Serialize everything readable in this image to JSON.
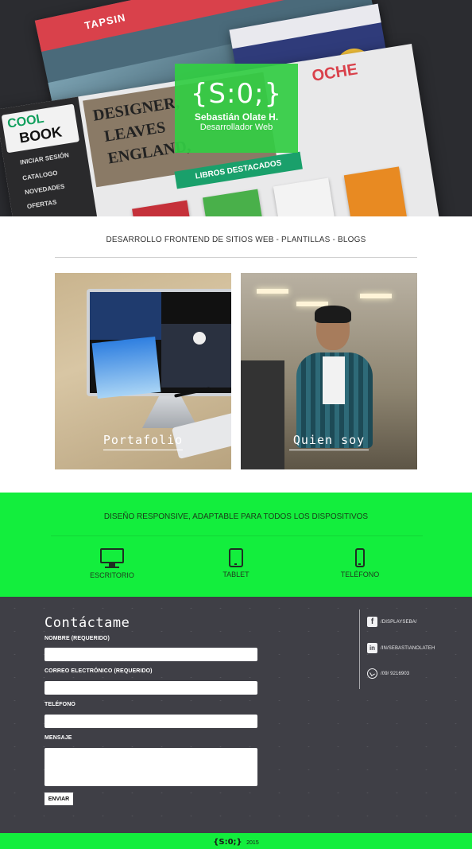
{
  "hero": {
    "logo": "{S:0;}",
    "name": "Sebastián Olate H.",
    "role": "Desarrollador Web",
    "mock": {
      "back_title": "TAPSIN",
      "cool": "COOL",
      "book": "BOOK",
      "nav": [
        "INICIAR SESIÓN",
        "CATALOGO",
        "NOVEDADES",
        "OFERTAS"
      ],
      "board_words": [
        "DESIGNER,",
        "LEAVES",
        "ENGLAND,"
      ],
      "ribbon": "LIBROS DESTACADOS",
      "red_word": "OCHE"
    }
  },
  "intro": {
    "tagline": "DESARROLLO FRONTEND DE SITIOS WEB - PLANTILLAS - BLOGS"
  },
  "cards": [
    {
      "title": "Portafolio"
    },
    {
      "title": "Quien soy"
    }
  ],
  "responsive": {
    "title": "DISEÑO RESPONSIVE, ADAPTABLE PARA TODOS LOS DISPOSITIVOS",
    "devices": [
      {
        "icon": "desktop-icon",
        "label": "ESCRITORIO"
      },
      {
        "icon": "tablet-icon",
        "label": "TABLET"
      },
      {
        "icon": "phone-icon",
        "label": "TELÉFONO"
      }
    ]
  },
  "contact": {
    "title": "Contáctame",
    "fields": [
      {
        "label": "NOMBRE (REQUERIDO)",
        "value": ""
      },
      {
        "label": "CORREO ELECTRÓNICO (REQUERIDO)",
        "value": ""
      },
      {
        "label": "TELÉFONO",
        "value": ""
      },
      {
        "label": "MENSAJE",
        "value": ""
      }
    ],
    "submit": "ENVIAR",
    "social": [
      {
        "icon": "facebook-icon",
        "glyph": "f",
        "text": "/DISPLAYSEBA/"
      },
      {
        "icon": "linkedin-icon",
        "glyph": "in",
        "text": "/IN/SEBASTIANOLATEH"
      },
      {
        "icon": "whatsapp-icon",
        "glyph": "",
        "text": "/09/ 9216903"
      }
    ]
  },
  "footer": {
    "logo": "{S:0;}",
    "year": "2015"
  },
  "colors": {
    "accent_green": "#13ee3d",
    "dark_bg": "#3f3f46",
    "hero_bg": "#2b2c30"
  }
}
